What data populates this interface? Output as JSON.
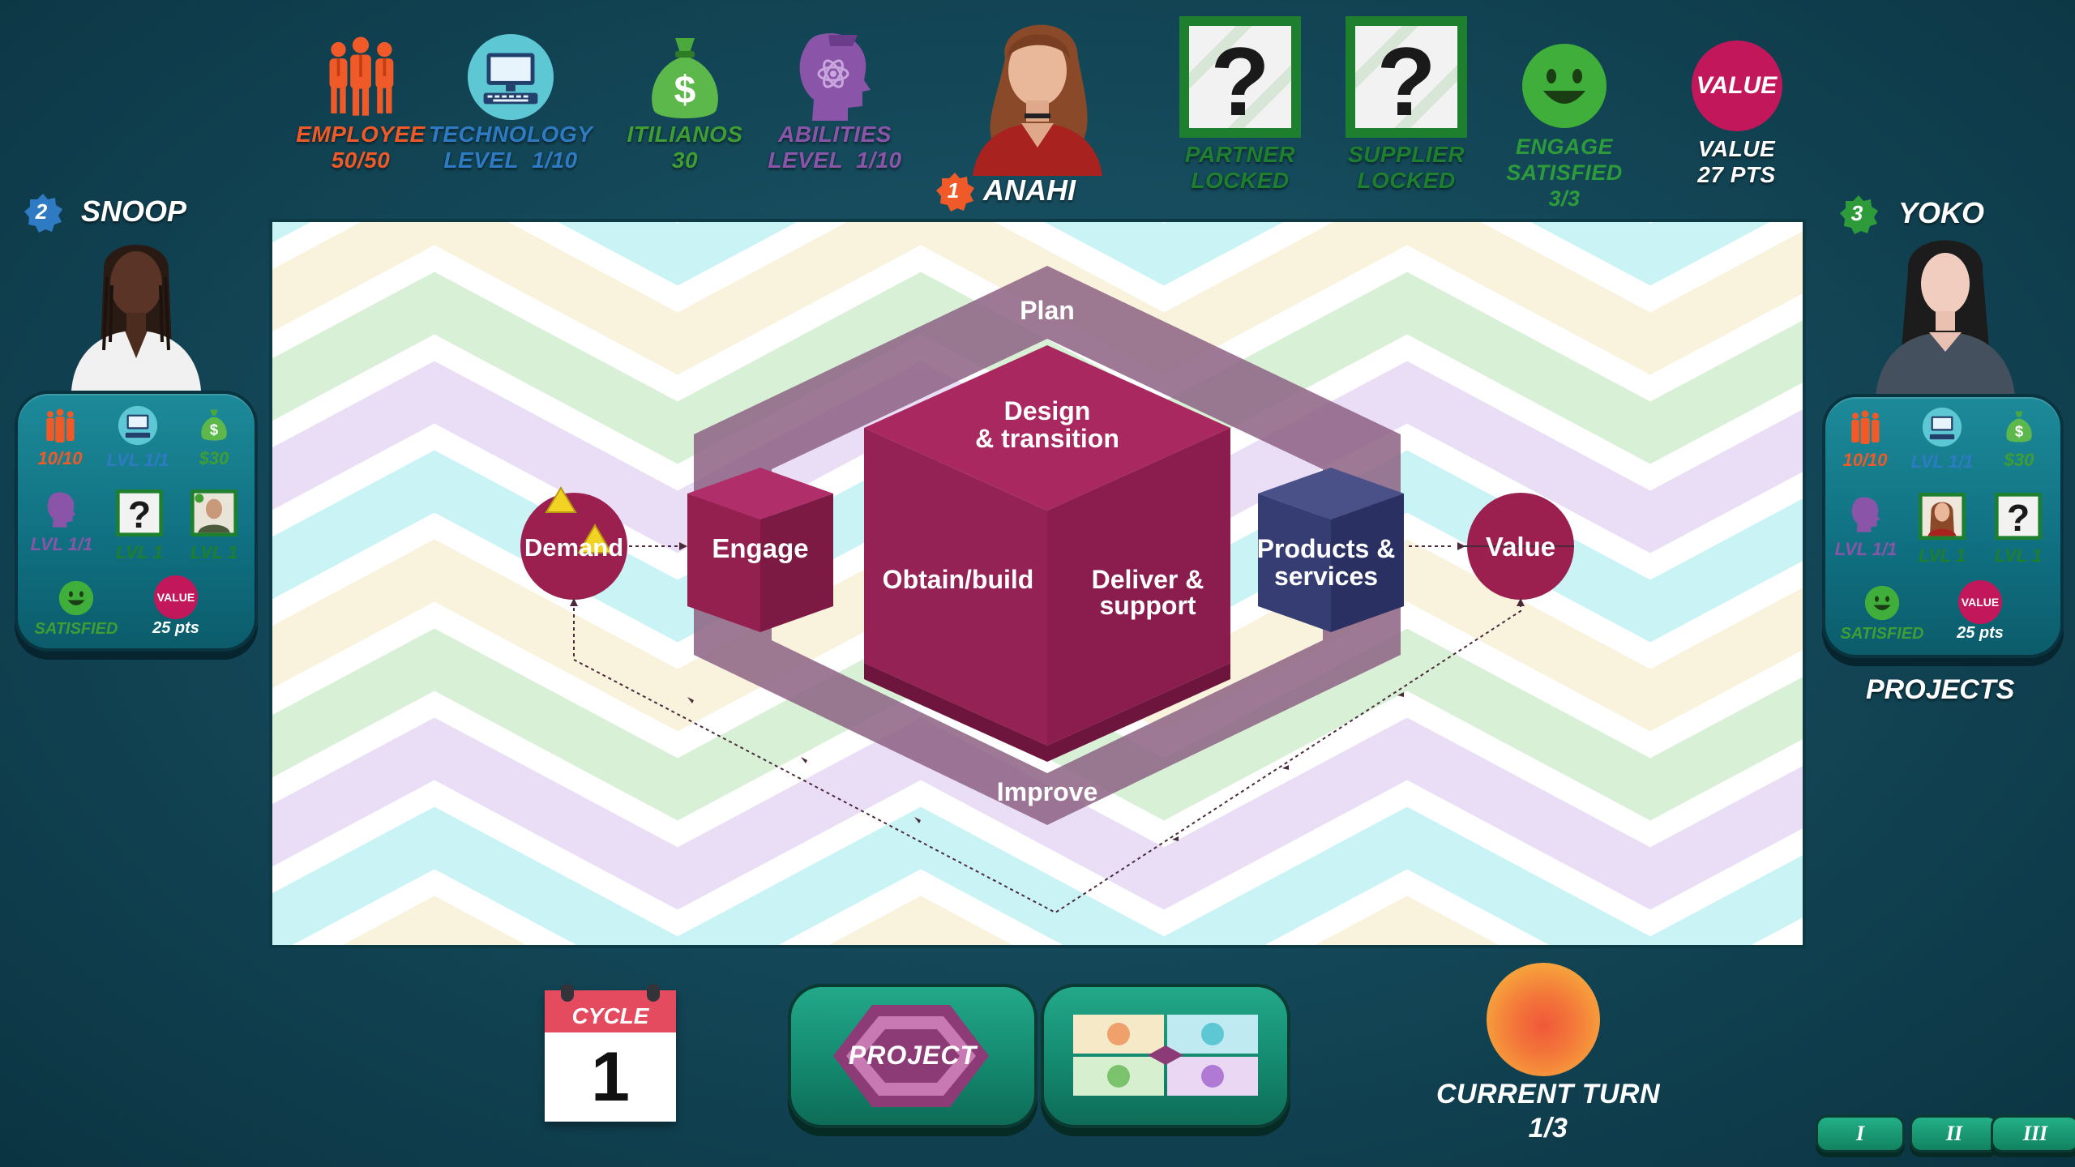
{
  "top_stats": {
    "employee": {
      "label": "EMPLOYEE",
      "value": "50/50",
      "color": "#f05a28"
    },
    "technology": {
      "label": "TECHNOLOGY",
      "value": "LEVEL  1/10",
      "color": "#2e7bc4"
    },
    "itilianos": {
      "label": "ITILIANOS",
      "value": "30",
      "color": "#3e9e33"
    },
    "abilities": {
      "label": "ABILITIES",
      "value": "LEVEL  1/10",
      "color": "#8a55a8"
    },
    "partner": {
      "label": "PARTNER",
      "value": "LOCKED",
      "color": "#1e7f2e"
    },
    "supplier": {
      "label": "SUPPLIER",
      "value": "LOCKED",
      "color": "#1e7f2e"
    },
    "engage": {
      "label": "ENGAGE",
      "sub": "SATISFIED",
      "value": "3/3",
      "color": "#2e9b3a"
    },
    "value": {
      "icon_text": "VALUE",
      "label": "VALUE",
      "value": "27 PTS",
      "color": "#c2185b"
    }
  },
  "current_player": {
    "number": "1",
    "name": "ANAHI",
    "badge_color": "#f05a28"
  },
  "players": {
    "left": {
      "number": "2",
      "name": "SNOOP",
      "badge_color": "#2e7bc4",
      "employee": "10/10",
      "technology": "LVL 1/1",
      "money": "$30",
      "abilities": "LVL 1/1",
      "partner": "LVL 1",
      "supplier": "LVL 1",
      "engage": "SATISFIED",
      "value_icon": "VALUE",
      "value": "25 pts"
    },
    "right": {
      "number": "3",
      "name": "YOKO",
      "badge_color": "#2e9b3a",
      "employee": "10/10",
      "technology": "LVL 1/1",
      "money": "$30",
      "abilities": "LVL 1/1",
      "partner": "LVL 1",
      "supplier": "LVL 1",
      "engage": "SATISFIED",
      "value_icon": "VALUE",
      "value": "25 pts",
      "projects_label": "PROJECTS"
    }
  },
  "diagram": {
    "plan": "Plan",
    "design_1": "Design",
    "design_2": "& transition",
    "obtain": "Obtain/build",
    "deliver_1": "Deliver &",
    "deliver_2": "support",
    "engage": "Engage",
    "products_1": "Products &",
    "products_2": "services",
    "demand": "Demand",
    "value": "Value",
    "improve": "Improve"
  },
  "cycle": {
    "label": "CYCLE",
    "value": "1"
  },
  "project_button": {
    "label": "PROJECT"
  },
  "current_turn": {
    "label": "CURRENT TURN",
    "value": "1/3"
  },
  "phase_buttons": [
    "I",
    "II",
    "III"
  ],
  "colors": {
    "accent_magenta": "#9b1f5e",
    "teal_button": "#148a6f",
    "background": "#14495a"
  }
}
